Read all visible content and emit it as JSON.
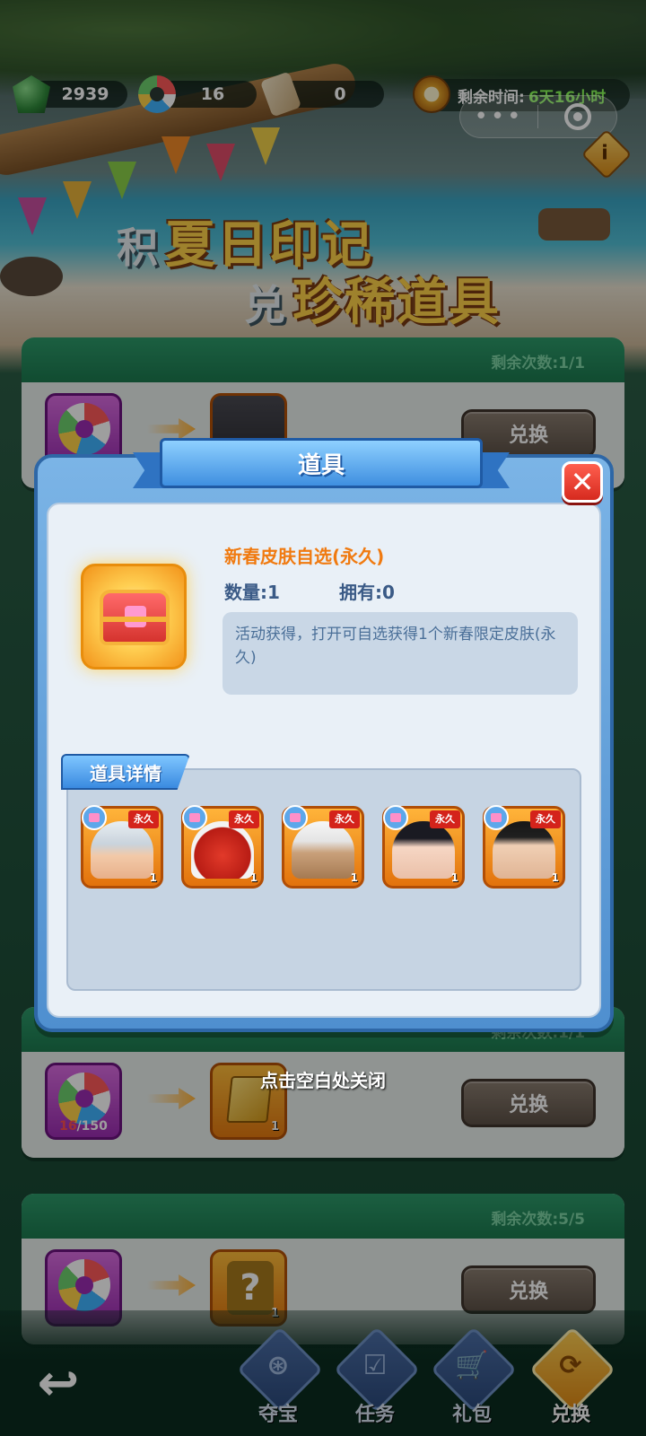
{
  "top_bar": {
    "currencies": [
      {
        "icon": "gem-icon",
        "value": "2939"
      },
      {
        "icon": "ring-icon",
        "value": "16"
      },
      {
        "icon": "scroll-icon",
        "value": "0"
      }
    ],
    "timer_label": "剩余时间:",
    "timer_value": "6天16小时",
    "menu_dots": "•••"
  },
  "banner": {
    "line1_small": "积",
    "line1_big": "夏日印记",
    "line2_small": "兑",
    "line2_big": "珍稀道具"
  },
  "cards": [
    {
      "remaining": "剩余次数:1/1",
      "button": "兑换"
    },
    {
      "remaining": "剩余次数:1/1",
      "button": "兑换",
      "progress_have": "16",
      "progress_need": "/150",
      "reward_qty": "1"
    },
    {
      "remaining": "剩余次数:5/5",
      "button": "兑换",
      "reward_qty": "1"
    }
  ],
  "modal": {
    "title": "道具",
    "item_name": "新春皮肤自选(永久)",
    "quantity": "数量:1",
    "owned": "拥有:0",
    "description": "活动获得，打开可自选获得1个新春限定皮肤(永久)",
    "details_tab": "道具详情",
    "skins": [
      {
        "tag": "永久",
        "qty": "1"
      },
      {
        "tag": "永久",
        "qty": "1"
      },
      {
        "tag": "永久",
        "qty": "1"
      },
      {
        "tag": "永久",
        "qty": "1"
      },
      {
        "tag": "永久",
        "qty": "1"
      }
    ],
    "close_hint": "点击空白处关闭"
  },
  "nav": [
    {
      "label": "夺宝",
      "icon": "wheel-icon"
    },
    {
      "label": "任务",
      "icon": "task-icon"
    },
    {
      "label": "礼包",
      "icon": "cart-icon"
    },
    {
      "label": "兑换",
      "icon": "exchange-icon",
      "active": true
    }
  ],
  "colors": {
    "accent_orange": "#f07a10",
    "timer_green": "#8cff5a",
    "modal_blue": "#4f8fcf",
    "close_red": "#d62a1e"
  }
}
